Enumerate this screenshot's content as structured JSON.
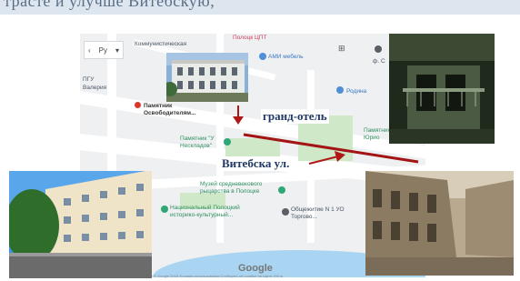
{
  "header": {
    "text": "трасте и улучше Витебскую,"
  },
  "map": {
    "language_selector": "Ру",
    "labels": {
      "kommunisticheskaya": "Коммунистическая",
      "polotsk_cpt": "Полоцк ЦПТ",
      "ami": "АМИ мебель",
      "pgu": "ПГУ",
      "valeria": "Валерия",
      "pamyatnik_osvoboditelyam_1": "Памятник",
      "pamyatnik_osvoboditelyam_2": "Освободителям...",
      "rodina": "Родина",
      "pamyatnik_yurio_1": "Памятник",
      "pamyatnik_yurio_2": "Юрио",
      "nesklad_1": "Памятник \"У",
      "nesklad_2": "Нескладов\"",
      "muzey_1": "Музей средневекового",
      "muzey_2": "рыцарства в Полоцке",
      "nats_1": "Национальный Полоцкий",
      "nats_2": "историко-культурный...",
      "obsh_1": "Общежитие N 1 УО",
      "obsh_2": "Торгово...",
      "f": "ф. С",
      "lang_prefix": "‹",
      "lang_caret": "▾",
      "grid": "⊞"
    },
    "google": "Google",
    "copyright": "Картографические данные © Google 2018   Условия использования   Сообщить об ошибке на карте   100 м"
  },
  "annotations": {
    "grand_hotel": "гранд-отель",
    "vitebskaya": "Витебска ул."
  },
  "colors": {
    "arrow": "#a31515",
    "annotation_text": "#1f3864",
    "park": "#cfe9c8",
    "water": "#a9d4f2"
  }
}
